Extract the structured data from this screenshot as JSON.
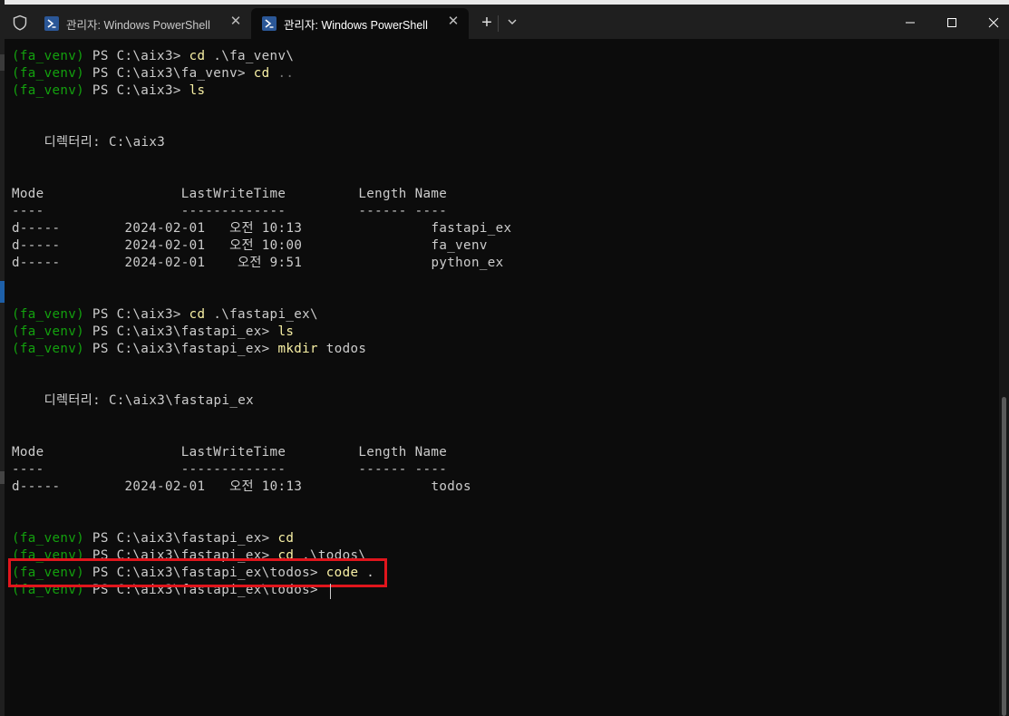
{
  "window": {
    "tabs": [
      {
        "label": "관리자: Windows PowerShell",
        "active": false
      },
      {
        "label": "관리자: Windows PowerShell",
        "active": true
      }
    ],
    "new_tab": "+",
    "controls": [
      "minimize",
      "maximize",
      "close"
    ]
  },
  "colors": {
    "background": "#0c0c0c",
    "prompt_venv": "#13a10e",
    "command": "#f9f1a5",
    "text": "#cccccc",
    "highlight_box": "#e0151c"
  },
  "terminal": {
    "lines": [
      {
        "venv": "(fa_venv)",
        "prompt": " PS C:\\aix3> ",
        "cmd": "cd",
        "arg": " .\\fa_venv\\"
      },
      {
        "venv": "(fa_venv)",
        "prompt": " PS C:\\aix3\\fa_venv> ",
        "cmd": "cd",
        "arg": " .."
      },
      {
        "venv": "(fa_venv)",
        "prompt": " PS C:\\aix3> ",
        "cmd": "ls",
        "arg": ""
      },
      {
        "text": "    디렉터리: C:\\aix3"
      },
      {
        "text": "Mode                 LastWriteTime         Length Name"
      },
      {
        "text": "----                 -------------         ------ ----"
      },
      {
        "text": "d-----        2024-02-01   오전 10:13                fastapi_ex"
      },
      {
        "text": "d-----        2024-02-01   오전 10:00                fa_venv"
      },
      {
        "text": "d-----        2024-02-01    오전 9:51                python_ex"
      },
      {
        "venv": "(fa_venv)",
        "prompt": " PS C:\\aix3> ",
        "cmd": "cd",
        "arg": " .\\fastapi_ex\\"
      },
      {
        "venv": "(fa_venv)",
        "prompt": " PS C:\\aix3\\fastapi_ex> ",
        "cmd": "ls",
        "arg": ""
      },
      {
        "venv": "(fa_venv)",
        "prompt": " PS C:\\aix3\\fastapi_ex> ",
        "cmd": "mkdir",
        "arg": " todos"
      },
      {
        "text": "    디렉터리: C:\\aix3\\fastapi_ex"
      },
      {
        "text": "Mode                 LastWriteTime         Length Name"
      },
      {
        "text": "----                 -------------         ------ ----"
      },
      {
        "text": "d-----        2024-02-01   오전 10:13                todos"
      },
      {
        "venv": "(fa_venv)",
        "prompt": " PS C:\\aix3\\fastapi_ex> ",
        "cmd": "cd",
        "arg": ""
      },
      {
        "venv": "(fa_venv)",
        "prompt": " PS C:\\aix3\\fastapi_ex> ",
        "cmd": "cd",
        "arg": " .\\todos\\"
      },
      {
        "venv": "(fa_venv)",
        "prompt": " PS C:\\aix3\\fastapi_ex\\todos> ",
        "cmd": "code",
        "arg": " ."
      },
      {
        "venv": "(fa_venv)",
        "prompt": " PS C:\\aix3\\fastapi_ex\\todos> ",
        "cmd": "",
        "arg": ""
      }
    ]
  }
}
